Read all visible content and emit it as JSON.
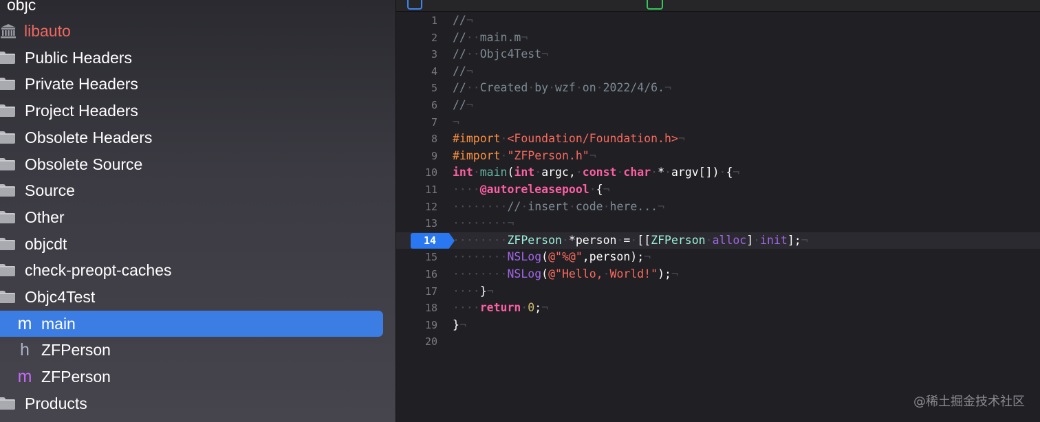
{
  "sidebar": {
    "top_label": "objc",
    "items": [
      {
        "label": "libauto",
        "icon": "library-icon",
        "kind": "library",
        "color": "#f0675f"
      },
      {
        "label": "Public Headers",
        "icon": "folder-icon",
        "kind": "folder"
      },
      {
        "label": "Private Headers",
        "icon": "folder-icon",
        "kind": "folder"
      },
      {
        "label": "Project Headers",
        "icon": "folder-icon",
        "kind": "folder"
      },
      {
        "label": "Obsolete Headers",
        "icon": "folder-icon",
        "kind": "folder"
      },
      {
        "label": "Obsolete Source",
        "icon": "folder-icon",
        "kind": "folder"
      },
      {
        "label": "Source",
        "icon": "folder-icon",
        "kind": "folder"
      },
      {
        "label": "Other",
        "icon": "folder-icon",
        "kind": "folder"
      },
      {
        "label": "objcdt",
        "icon": "folder-icon",
        "kind": "folder"
      },
      {
        "label": "check-preopt-caches",
        "icon": "folder-icon",
        "kind": "folder"
      },
      {
        "label": "Objc4Test",
        "icon": "folder-icon",
        "kind": "folder"
      },
      {
        "label": "main",
        "icon": "m-file-icon",
        "glyph": "m",
        "kind": "file",
        "selected": true
      },
      {
        "label": "ZFPerson",
        "icon": "h-file-icon",
        "glyph": "h",
        "kind": "file"
      },
      {
        "label": "ZFPerson",
        "icon": "m-file-icon",
        "glyph": "m",
        "kind": "file"
      },
      {
        "label": "Products",
        "icon": "folder-icon",
        "kind": "folder"
      }
    ]
  },
  "editor": {
    "current_line": 14,
    "lines": [
      {
        "n": "1",
        "tokens": [
          [
            "c-comment",
            "//"
          ],
          [
            "c-inv",
            "¬"
          ]
        ]
      },
      {
        "n": "2",
        "tokens": [
          [
            "c-comment",
            "//"
          ],
          [
            "c-inv",
            "··"
          ],
          [
            "c-comment",
            "main.m"
          ],
          [
            "c-inv",
            "¬"
          ]
        ]
      },
      {
        "n": "3",
        "tokens": [
          [
            "c-comment",
            "//"
          ],
          [
            "c-inv",
            "··"
          ],
          [
            "c-comment",
            "Objc4Test"
          ],
          [
            "c-inv",
            "¬"
          ]
        ]
      },
      {
        "n": "4",
        "tokens": [
          [
            "c-comment",
            "//"
          ],
          [
            "c-inv",
            "¬"
          ]
        ]
      },
      {
        "n": "5",
        "tokens": [
          [
            "c-comment",
            "//"
          ],
          [
            "c-inv",
            "··"
          ],
          [
            "c-comment",
            "Created"
          ],
          [
            "c-inv",
            "·"
          ],
          [
            "c-comment",
            "by"
          ],
          [
            "c-inv",
            "·"
          ],
          [
            "c-comment",
            "wzf"
          ],
          [
            "c-inv",
            "·"
          ],
          [
            "c-comment",
            "on"
          ],
          [
            "c-inv",
            "·"
          ],
          [
            "c-comment",
            "2022/4/6."
          ],
          [
            "c-inv",
            "¬"
          ]
        ]
      },
      {
        "n": "6",
        "tokens": [
          [
            "c-comment",
            "//"
          ],
          [
            "c-inv",
            "¬"
          ]
        ]
      },
      {
        "n": "7",
        "tokens": [
          [
            "c-inv",
            "¬"
          ]
        ]
      },
      {
        "n": "8",
        "tokens": [
          [
            "c-pre",
            "#import"
          ],
          [
            "c-inv",
            "·"
          ],
          [
            "c-str",
            "<Foundation/Foundation.h>"
          ],
          [
            "c-inv",
            "¬"
          ]
        ]
      },
      {
        "n": "9",
        "tokens": [
          [
            "c-pre",
            "#import"
          ],
          [
            "c-inv",
            "·"
          ],
          [
            "c-str",
            "\"ZFPerson.h\""
          ],
          [
            "c-inv",
            "¬"
          ]
        ]
      },
      {
        "n": "10",
        "tokens": [
          [
            "c-kw",
            "int"
          ],
          [
            "c-inv",
            "·"
          ],
          [
            "c-fn",
            "main"
          ],
          [
            "c-plain",
            "("
          ],
          [
            "c-kw",
            "int"
          ],
          [
            "c-inv",
            "·"
          ],
          [
            "c-plain",
            "argc,"
          ],
          [
            "c-inv",
            "·"
          ],
          [
            "c-kw",
            "const"
          ],
          [
            "c-inv",
            "·"
          ],
          [
            "c-kw",
            "char"
          ],
          [
            "c-inv",
            "·"
          ],
          [
            "c-plain",
            "*"
          ],
          [
            "c-inv",
            "·"
          ],
          [
            "c-plain",
            "argv[])"
          ],
          [
            "c-inv",
            "·"
          ],
          [
            "c-plain",
            "{"
          ],
          [
            "c-inv",
            "¬"
          ]
        ]
      },
      {
        "n": "11",
        "tokens": [
          [
            "c-inv",
            "····"
          ],
          [
            "c-kw",
            "@autoreleasepool"
          ],
          [
            "c-inv",
            "·"
          ],
          [
            "c-plain",
            "{"
          ],
          [
            "c-inv",
            "¬"
          ]
        ]
      },
      {
        "n": "12",
        "tokens": [
          [
            "c-inv",
            "········"
          ],
          [
            "c-comment",
            "//"
          ],
          [
            "c-inv",
            "·"
          ],
          [
            "c-comment",
            "insert"
          ],
          [
            "c-inv",
            "·"
          ],
          [
            "c-comment",
            "code"
          ],
          [
            "c-inv",
            "·"
          ],
          [
            "c-comment",
            "here..."
          ],
          [
            "c-inv",
            "¬"
          ]
        ]
      },
      {
        "n": "13",
        "tokens": [
          [
            "c-inv",
            "········¬"
          ]
        ]
      },
      {
        "n": "14",
        "tokens": [
          [
            "c-inv",
            "········"
          ],
          [
            "c-typ",
            "ZFPerson"
          ],
          [
            "c-inv",
            "·"
          ],
          [
            "c-plain",
            "*person"
          ],
          [
            "c-inv",
            "·"
          ],
          [
            "c-plain",
            "="
          ],
          [
            "c-inv",
            "·"
          ],
          [
            "c-plain",
            "[["
          ],
          [
            "c-typ",
            "ZFPerson"
          ],
          [
            "c-inv",
            "·"
          ],
          [
            "c-mth",
            "alloc"
          ],
          [
            "c-plain",
            "]"
          ],
          [
            "c-inv",
            "·"
          ],
          [
            "c-mth",
            "init"
          ],
          [
            "c-plain",
            "];"
          ],
          [
            "c-inv",
            "¬"
          ]
        ]
      },
      {
        "n": "15",
        "tokens": [
          [
            "c-inv",
            "········"
          ],
          [
            "c-mth",
            "NSLog"
          ],
          [
            "c-plain",
            "("
          ],
          [
            "c-str",
            "@\"%@\""
          ],
          [
            "c-plain",
            ",person);"
          ],
          [
            "c-inv",
            "¬"
          ]
        ]
      },
      {
        "n": "16",
        "tokens": [
          [
            "c-inv",
            "········"
          ],
          [
            "c-mth",
            "NSLog"
          ],
          [
            "c-plain",
            "("
          ],
          [
            "c-str",
            "@\"Hello,"
          ],
          [
            "c-inv",
            "·"
          ],
          [
            "c-str",
            "World!\""
          ],
          [
            "c-plain",
            ");"
          ],
          [
            "c-inv",
            "¬"
          ]
        ]
      },
      {
        "n": "17",
        "tokens": [
          [
            "c-inv",
            "····"
          ],
          [
            "c-plain",
            "}"
          ],
          [
            "c-inv",
            "¬"
          ]
        ]
      },
      {
        "n": "18",
        "tokens": [
          [
            "c-inv",
            "····"
          ],
          [
            "c-kw",
            "return"
          ],
          [
            "c-inv",
            "·"
          ],
          [
            "c-num",
            "0"
          ],
          [
            "c-plain",
            ";"
          ],
          [
            "c-inv",
            "¬"
          ]
        ]
      },
      {
        "n": "19",
        "tokens": [
          [
            "c-plain",
            "}"
          ],
          [
            "c-inv",
            "¬"
          ]
        ]
      },
      {
        "n": "20",
        "tokens": []
      }
    ]
  },
  "watermark": "@稀土掘金技术社区"
}
